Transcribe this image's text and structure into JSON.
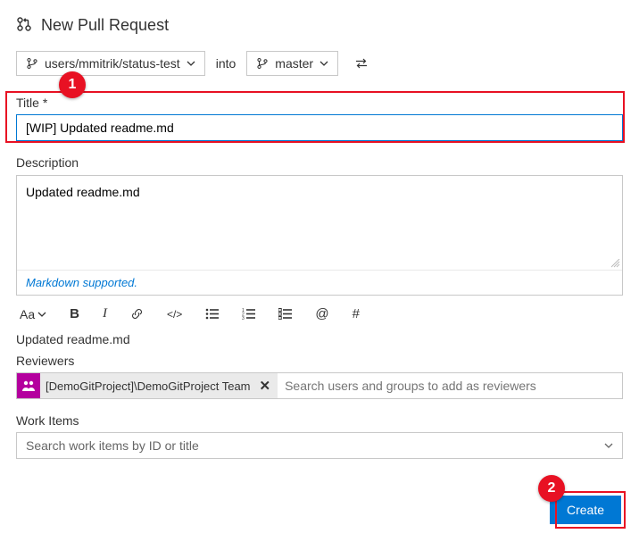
{
  "header": {
    "title": "New Pull Request"
  },
  "branches": {
    "source": "users/mmitrik/status-test",
    "into_label": "into",
    "target": "master"
  },
  "title_field": {
    "label": "Title *",
    "value": "[WIP] Updated readme.md"
  },
  "description_field": {
    "label": "Description",
    "value": "Updated readme.md",
    "markdown_note": "Markdown supported."
  },
  "toolbar": {
    "font_size_label": "Aa",
    "bold": "B",
    "italic": "I",
    "code": "</>",
    "at": "@",
    "hash": "#"
  },
  "preview_text": "Updated readme.md",
  "reviewers": {
    "label": "Reviewers",
    "chip_name": "[DemoGitProject]\\DemoGitProject Team",
    "placeholder": "Search users and groups to add as reviewers"
  },
  "workitems": {
    "label": "Work Items",
    "placeholder": "Search work items by ID or title"
  },
  "create_button": "Create",
  "annotations": {
    "badge1": "1",
    "badge2": "2"
  }
}
